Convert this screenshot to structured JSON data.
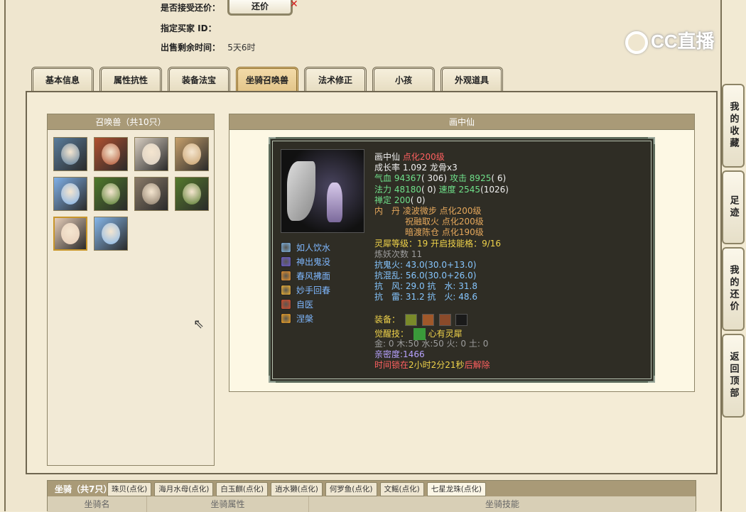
{
  "header": {
    "accept_counter_label": "是否接受还价：",
    "counter_button_label": "还价",
    "buyer_label": "指定买家 ID：",
    "buyer_value": "",
    "remaining_label": "出售剩余时间：",
    "remaining_value": "5天6时"
  },
  "logo_text": "CC直播",
  "tabs": [
    {
      "label": "基本信息",
      "active": false
    },
    {
      "label": "属性抗性",
      "active": false
    },
    {
      "label": "装备法宝",
      "active": false
    },
    {
      "label": "坐骑召唤兽",
      "active": true
    },
    {
      "label": "法术修正",
      "active": false
    },
    {
      "label": "小孩",
      "active": false
    },
    {
      "label": "外观道具",
      "active": false
    }
  ],
  "pet_panel": {
    "title": "召唤兽（共10只）",
    "pets": [
      {
        "name": "pet-1",
        "color": "#5a7d9c"
      },
      {
        "name": "pet-2",
        "color": "#b0502f"
      },
      {
        "name": "pet-3",
        "color": "#d9cfc2"
      },
      {
        "name": "pet-4",
        "color": "#c7a06b"
      },
      {
        "name": "pet-5",
        "color": "#7fb0e8"
      },
      {
        "name": "pet-6",
        "color": "#4f7a2a"
      },
      {
        "name": "pet-7",
        "color": "#8a7a68"
      },
      {
        "name": "pet-8",
        "color": "#557a2c"
      },
      {
        "name": "pet-9",
        "color": "#e6cdb8",
        "selected": true
      },
      {
        "name": "pet-10",
        "color": "#86b7ea"
      }
    ]
  },
  "detail": {
    "panel_title": "画中仙",
    "skills": [
      {
        "label": "如人饮水",
        "icon_color": "#7ab0e0"
      },
      {
        "label": "神出鬼没",
        "icon_color": "#6a5acd"
      },
      {
        "label": "春风拂面",
        "icon_color": "#e8902a"
      },
      {
        "label": "妙手回春",
        "icon_color": "#f0b030"
      },
      {
        "label": "自医",
        "icon_color": "#d84a2a"
      },
      {
        "label": "涅槃",
        "icon_color": "#f0a020"
      }
    ],
    "name": "画中仙",
    "name_suffix": "点化200级",
    "growth": "成长率 1.092 龙骨x3",
    "hp_label": "气血",
    "hp": "94367",
    "hp_extra": "( 306)",
    "atk_label": "攻击",
    "atk": "8925",
    "atk_extra": "( 6)",
    "mp_label": "法力",
    "mp": "48180",
    "mp_extra": "( 0)",
    "spd_label": "速度",
    "spd": "2545",
    "spd_extra": "(1026)",
    "zen_label": "禅定",
    "zen": "200",
    "zen_extra": "( 0)",
    "dan1": "内　丹 凌波微步 点化200级",
    "dan2": "祝融取火 点化200级",
    "dan3": "暗渡陈仓 点化190级",
    "lingxi": "灵犀等级：19 开启技能格：9/16",
    "refine": "炼妖次数 11",
    "resist_ghost_label": "抗鬼火:",
    "resist_ghost": " 43.0(30.0+13.0)",
    "resist_chaos_label": "抗混乱:",
    "resist_chaos": " 56.0(30.0+26.0)",
    "resist_line1": "抗　风: 29.0 抗　水: 31.8",
    "resist_line2": "抗　雷: 31.2 抗　火: 48.6",
    "equip_label": "装备：",
    "awaken_label": "觉醒技：",
    "awaken_skill": "心有灵犀",
    "elements": "金: 0 木:50 水:50 火: 0 土: 0",
    "intimacy": "亲密度:1466",
    "lock_prefix": "时间锁在",
    "lock_time": "2小时2分21秒",
    "lock_suffix": "后解除"
  },
  "side_nav": [
    {
      "label": "我的收藏"
    },
    {
      "label": "足迹"
    },
    {
      "label": "我的还价"
    },
    {
      "label": "返回顶部"
    }
  ],
  "mount": {
    "title": "坐骑（共7只）",
    "tabs": [
      {
        "label": "珠贝(点化)",
        "active": false
      },
      {
        "label": "海月水母(点化)",
        "active": false
      },
      {
        "label": "白玉麒(点化)",
        "active": false
      },
      {
        "label": "逍水獭(点化)",
        "active": false
      },
      {
        "label": "何罗鱼(点化)",
        "active": false
      },
      {
        "label": "文鳐(点化)",
        "active": false
      },
      {
        "label": "七星龙珠(点化)",
        "active": true
      }
    ],
    "columns": [
      "坐骑名",
      "坐骑属性",
      "坐骑技能"
    ]
  }
}
